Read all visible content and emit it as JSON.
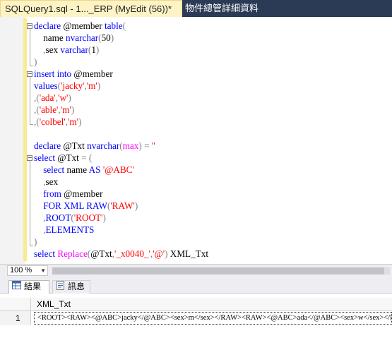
{
  "tabs": {
    "active_label": "SQLQuery1.sql - 1..._ERP (MyEdit (56))*",
    "inactive_label": "物件總管詳細資料"
  },
  "editor": {
    "lines": [
      [
        {
          "t": "declare ",
          "c": "kw"
        },
        {
          "t": "@member ",
          "c": "var"
        },
        {
          "t": "table",
          "c": "kw"
        },
        {
          "t": "(",
          "c": "gr"
        }
      ],
      [
        {
          "t": "    name ",
          "c": "var"
        },
        {
          "t": "nvarchar",
          "c": "kw"
        },
        {
          "t": "(",
          "c": "gr"
        },
        {
          "t": "50",
          "c": "var"
        },
        {
          "t": ")",
          "c": "gr"
        }
      ],
      [
        {
          "t": "    ",
          "c": "var"
        },
        {
          "t": ",",
          "c": "gr"
        },
        {
          "t": "sex ",
          "c": "var"
        },
        {
          "t": "varchar",
          "c": "kw"
        },
        {
          "t": "(",
          "c": "gr"
        },
        {
          "t": "1",
          "c": "var"
        },
        {
          "t": ")",
          "c": "gr"
        }
      ],
      [
        {
          "t": ")",
          "c": "gr"
        }
      ],
      [
        {
          "t": "insert into ",
          "c": "kw"
        },
        {
          "t": "@member",
          "c": "var"
        }
      ],
      [
        {
          "t": "values",
          "c": "kw"
        },
        {
          "t": "(",
          "c": "gr"
        },
        {
          "t": "'jacky'",
          "c": "str"
        },
        {
          "t": ",",
          "c": "gr"
        },
        {
          "t": "'m'",
          "c": "str"
        },
        {
          "t": ")",
          "c": "gr"
        }
      ],
      [
        {
          "t": ",(",
          "c": "gr"
        },
        {
          "t": "'ada'",
          "c": "str"
        },
        {
          "t": ",",
          "c": "gr"
        },
        {
          "t": "'w'",
          "c": "str"
        },
        {
          "t": ")",
          "c": "gr"
        }
      ],
      [
        {
          "t": ",(",
          "c": "gr"
        },
        {
          "t": "'able'",
          "c": "str"
        },
        {
          "t": ",",
          "c": "gr"
        },
        {
          "t": "'m'",
          "c": "str"
        },
        {
          "t": ")",
          "c": "gr"
        }
      ],
      [
        {
          "t": ",(",
          "c": "gr"
        },
        {
          "t": "'colbel'",
          "c": "str"
        },
        {
          "t": ",",
          "c": "gr"
        },
        {
          "t": "'m'",
          "c": "str"
        },
        {
          "t": ")",
          "c": "gr"
        }
      ],
      [],
      [
        {
          "t": "declare ",
          "c": "kw"
        },
        {
          "t": "@Txt ",
          "c": "var"
        },
        {
          "t": "nvarchar",
          "c": "kw"
        },
        {
          "t": "(",
          "c": "gr"
        },
        {
          "t": "max",
          "c": "fn"
        },
        {
          "t": ") = ",
          "c": "gr"
        },
        {
          "t": "''",
          "c": "str"
        }
      ],
      [
        {
          "t": "select ",
          "c": "kw"
        },
        {
          "t": "@Txt ",
          "c": "var"
        },
        {
          "t": "= (",
          "c": "gr"
        }
      ],
      [
        {
          "t": "    select ",
          "c": "kw"
        },
        {
          "t": "name ",
          "c": "var"
        },
        {
          "t": "AS ",
          "c": "kw"
        },
        {
          "t": "'@ABC'",
          "c": "str"
        }
      ],
      [
        {
          "t": "    ",
          "c": "var"
        },
        {
          "t": ",",
          "c": "gr"
        },
        {
          "t": "sex",
          "c": "var"
        }
      ],
      [
        {
          "t": "    from ",
          "c": "kw"
        },
        {
          "t": "@member",
          "c": "var"
        }
      ],
      [
        {
          "t": "    FOR XML RAW",
          "c": "kw"
        },
        {
          "t": "(",
          "c": "gr"
        },
        {
          "t": "'RAW'",
          "c": "str"
        },
        {
          "t": ")",
          "c": "gr"
        }
      ],
      [
        {
          "t": "    ",
          "c": "var"
        },
        {
          "t": ",",
          "c": "gr"
        },
        {
          "t": "ROOT",
          "c": "kw"
        },
        {
          "t": "(",
          "c": "gr"
        },
        {
          "t": "'ROOT'",
          "c": "str"
        },
        {
          "t": ")",
          "c": "gr"
        }
      ],
      [
        {
          "t": "    ",
          "c": "var"
        },
        {
          "t": ",",
          "c": "gr"
        },
        {
          "t": "ELEMENTS",
          "c": "kw"
        }
      ],
      [
        {
          "t": ")",
          "c": "gr"
        }
      ],
      [
        {
          "t": "select ",
          "c": "kw"
        },
        {
          "t": "Replace",
          "c": "fn"
        },
        {
          "t": "(",
          "c": "gr"
        },
        {
          "t": "@Txt",
          "c": "var"
        },
        {
          "t": ",",
          "c": "gr"
        },
        {
          "t": "'_x0040_'",
          "c": "str"
        },
        {
          "t": ",",
          "c": "gr"
        },
        {
          "t": "'@'",
          "c": "str"
        },
        {
          "t": ") ",
          "c": "gr"
        },
        {
          "t": "XML_Txt",
          "c": "var"
        }
      ]
    ]
  },
  "zoom": {
    "value": "100 %"
  },
  "results": {
    "tab_results": "結果",
    "tab_messages": "訊息",
    "column_header": "XML_Txt",
    "rows": [
      {
        "num": "1",
        "value": "<ROOT><RAW><@ABC>jacky</@ABC><sex>m</sex></RAW><RAW><@ABC>ada</@ABC><sex>w</sex></RAW>"
      }
    ]
  },
  "colors": {
    "keyword": "#0000ff",
    "string": "#ff0000",
    "function": "#ff00ff",
    "operator": "#808080",
    "tab_active_bg": "#fdf3c4",
    "tabstrip_bg": "#2b3a55"
  }
}
